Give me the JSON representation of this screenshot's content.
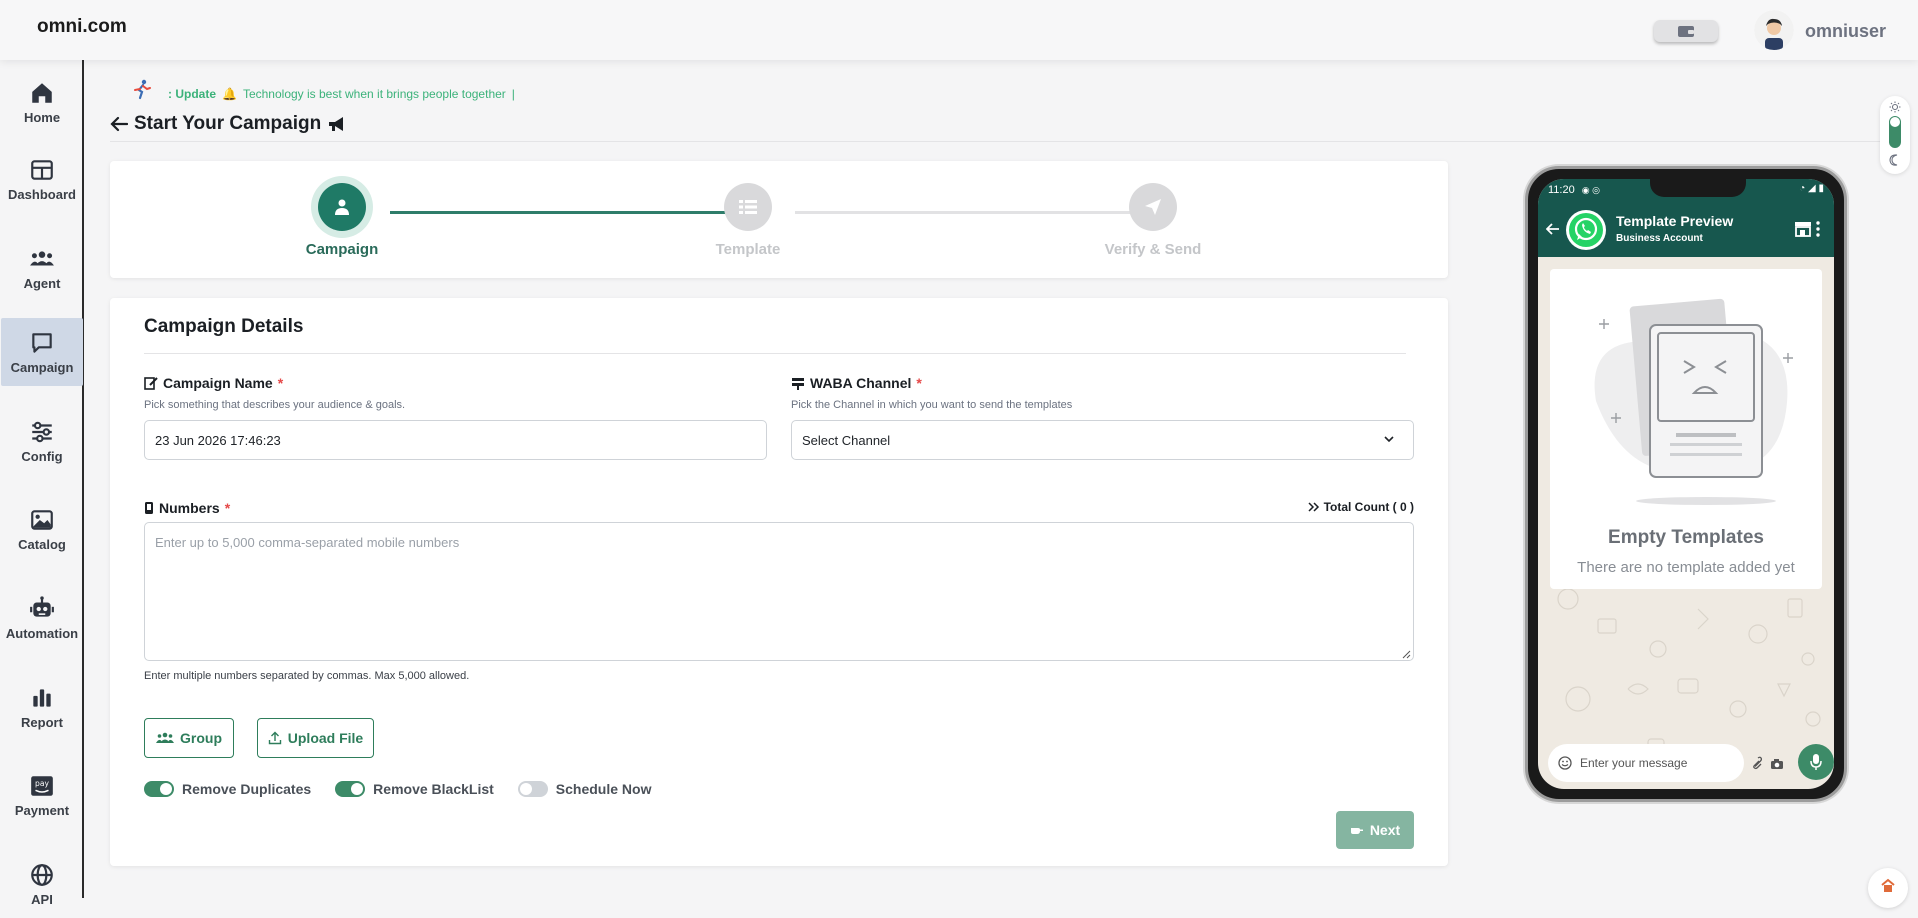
{
  "topbar": {
    "brand": "omni.com",
    "username": "omniuser"
  },
  "sidebar": {
    "items": [
      {
        "label": "Home",
        "icon": "home-icon"
      },
      {
        "label": "Dashboard",
        "icon": "dashboard-icon"
      },
      {
        "label": "Agent",
        "icon": "agent-icon"
      },
      {
        "label": "Campaign",
        "icon": "campaign-icon",
        "active": true
      },
      {
        "label": "Config",
        "icon": "config-icon"
      },
      {
        "label": "Catalog",
        "icon": "catalog-icon"
      },
      {
        "label": "Automation",
        "icon": "automation-icon"
      },
      {
        "label": "Report",
        "icon": "report-icon"
      },
      {
        "label": "Payment",
        "icon": "payment-icon"
      },
      {
        "label": "API",
        "icon": "api-icon"
      }
    ]
  },
  "marquee": {
    "prefix": ": Update",
    "text": "Technology is best when it brings people together"
  },
  "page": {
    "title": "Start Your Campaign"
  },
  "stepper": {
    "steps": [
      {
        "label": "Campaign",
        "state": "active"
      },
      {
        "label": "Template",
        "state": "inactive"
      },
      {
        "label": "Verify & Send",
        "state": "inactive"
      }
    ]
  },
  "details": {
    "title": "Campaign Details",
    "campaign_name": {
      "label": "Campaign Name",
      "required": "*",
      "hint": "Pick something that describes your audience & goals.",
      "value": "23 Jun 2026 17:46:23"
    },
    "waba_channel": {
      "label": "WABA Channel",
      "required": "*",
      "hint": "Pick the Channel in which you want to send the templates",
      "value": "Select Channel"
    },
    "numbers": {
      "label": "Numbers",
      "required": "*",
      "placeholder": "Enter up to 5,000 comma-separated mobile numbers",
      "hint": "Enter multiple numbers separated by commas. Max 5,000 allowed.",
      "total_count": "Total Count ( 0 )"
    },
    "buttons": {
      "group": "Group",
      "upload": "Upload File",
      "next": "Next"
    },
    "toggles": [
      {
        "label": "Remove Duplicates",
        "on": true
      },
      {
        "label": "Remove BlackList",
        "on": true
      },
      {
        "label": "Schedule Now",
        "on": false
      }
    ]
  },
  "preview": {
    "time": "11:20",
    "title": "Template Preview",
    "subtitle": "Business Account",
    "empty_title": "Empty Templates",
    "empty_sub": "There are no template added yet",
    "message_placeholder": "Enter your message"
  },
  "colors": {
    "accent": "#17574e",
    "primary_green": "#3d8b68",
    "active_nav": "#cfd8e6"
  }
}
